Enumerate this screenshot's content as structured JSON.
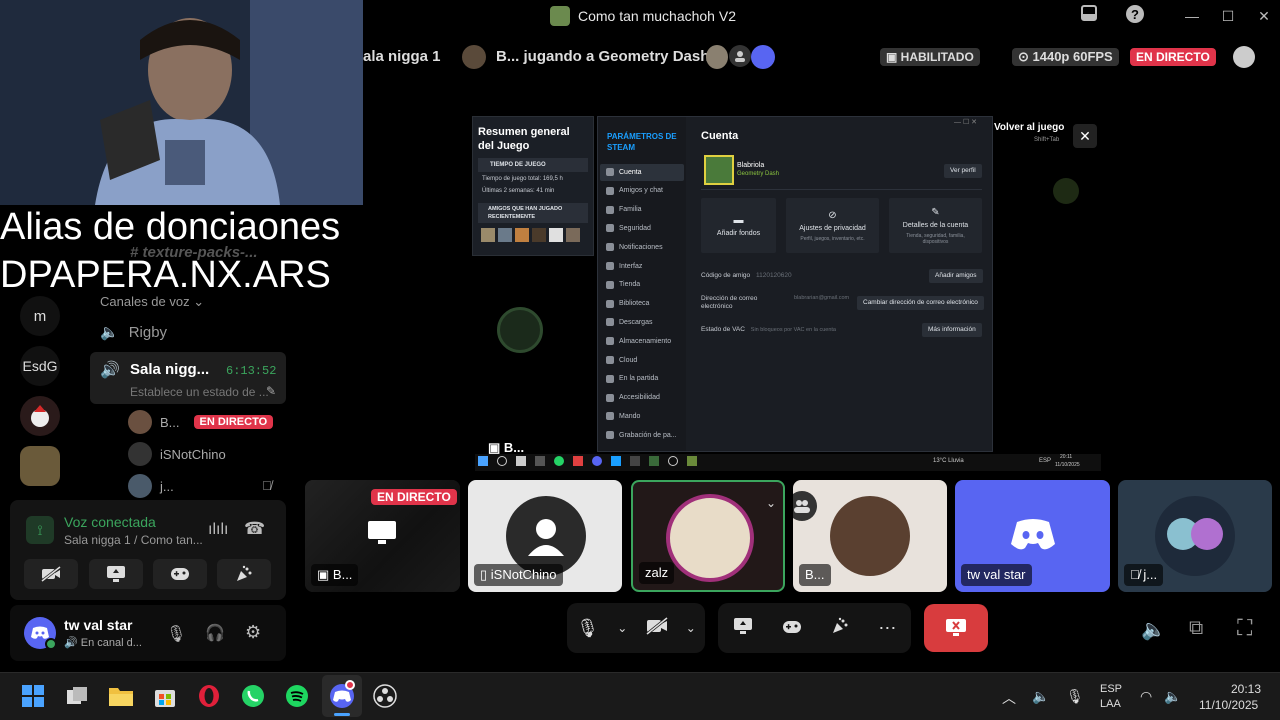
{
  "window": {
    "title": "Como tan muchachoh V2"
  },
  "overlay_text": {
    "line1": "Alias de donciaones",
    "line2": "DPAPERA.NX.ARS"
  },
  "guilds": [
    "m",
    "EsdG"
  ],
  "channels": {
    "text_faded_1": "texture-packs-...",
    "voice_header": "Canales de voz",
    "items": [
      {
        "name": "Rigby"
      },
      {
        "name": "Sala nigg...",
        "time": "6:13:52",
        "status": "Establece un estado de ..."
      }
    ],
    "voice_users": [
      {
        "name": "B...",
        "badge": "EN DIRECTO"
      },
      {
        "name": "iSNotChino"
      },
      {
        "name": "j..."
      }
    ]
  },
  "voice_panel": {
    "status": "Voz conectada",
    "location": "Sala nigga 1 / Como tan..."
  },
  "user_panel": {
    "name": "tw val star",
    "status": "En canal d..."
  },
  "stream_header": {
    "channel": "ala nigga 1",
    "activity": "B... jugando a Geometry Dash",
    "enabled": "HABILITADO",
    "quality": "1440p 60FPS",
    "live": "EN DIRECTO"
  },
  "steam_overlay": {
    "game_summary_title": "Resumen general del Juego",
    "playtime_header": "TIEMPO DE JUEGO",
    "playtime_total": "Tiempo de juego total: 169,5 h",
    "playtime_recent": "Últimas 2 semanas: 41 min",
    "friends_header": "AMIGOS QUE HAN JUGADO RECIENTEMENTE",
    "return_label": "Volver al juego",
    "return_hint": "Shift+Tab",
    "params_title": "PARÁMETROS DE STEAM",
    "nav": [
      "Cuenta",
      "Amigos y chat",
      "Familia",
      "Seguridad",
      "Notificaciones",
      "Interfaz",
      "Tienda",
      "Biblioteca",
      "Descargas",
      "Almacenamiento",
      "Cloud",
      "En la partida",
      "Accesibilidad",
      "Mando",
      "Grabación de pa..."
    ],
    "section_title": "Cuenta",
    "profile_name": "Blabriola",
    "profile_game": "Geometry Dash",
    "view_profile": "Ver perfil",
    "cards": [
      {
        "title": "Añadir fondos",
        "sub": ""
      },
      {
        "title": "Ajustes de privacidad",
        "sub": "Perfil, juegos, inventario, etc."
      },
      {
        "title": "Detalles de la cuenta",
        "sub": "Tienda, seguridad, familia, dispositivos"
      }
    ],
    "friend_code_label": "Código de amigo",
    "friend_code": "1120120620",
    "add_friends": "Añadir amigos",
    "email_label": "Dirección de correo electrónico",
    "email_value": "blabrarian@gmail.com",
    "change_email": "Cambiar dirección de correo electrónico",
    "vac_label": "Estado de VAC",
    "vac_value": "Sin bloqueos por VAC en la cuenta",
    "more_info": "Más información"
  },
  "stream_taskbar": {
    "weather": "13°C Lluvia",
    "lang": "ESP",
    "time": "20:11",
    "date": "11/10/2025"
  },
  "stream_label": "B...",
  "tiles": [
    {
      "label": "B...",
      "badge": "EN DIRECTO"
    },
    {
      "label": "iSNotChino"
    },
    {
      "label": "zalz"
    },
    {
      "label": "B..."
    },
    {
      "label": "tw val star"
    },
    {
      "label": "j..."
    }
  ],
  "taskbar": {
    "lang": "ESP",
    "layout": "LAA",
    "time": "20:13",
    "date": "11/10/2025"
  },
  "colors": {
    "live_red": "#e0344a",
    "connected_green": "#3ba55d",
    "discord_blurple": "#5865f2",
    "hangup_red": "#d83c3e"
  }
}
